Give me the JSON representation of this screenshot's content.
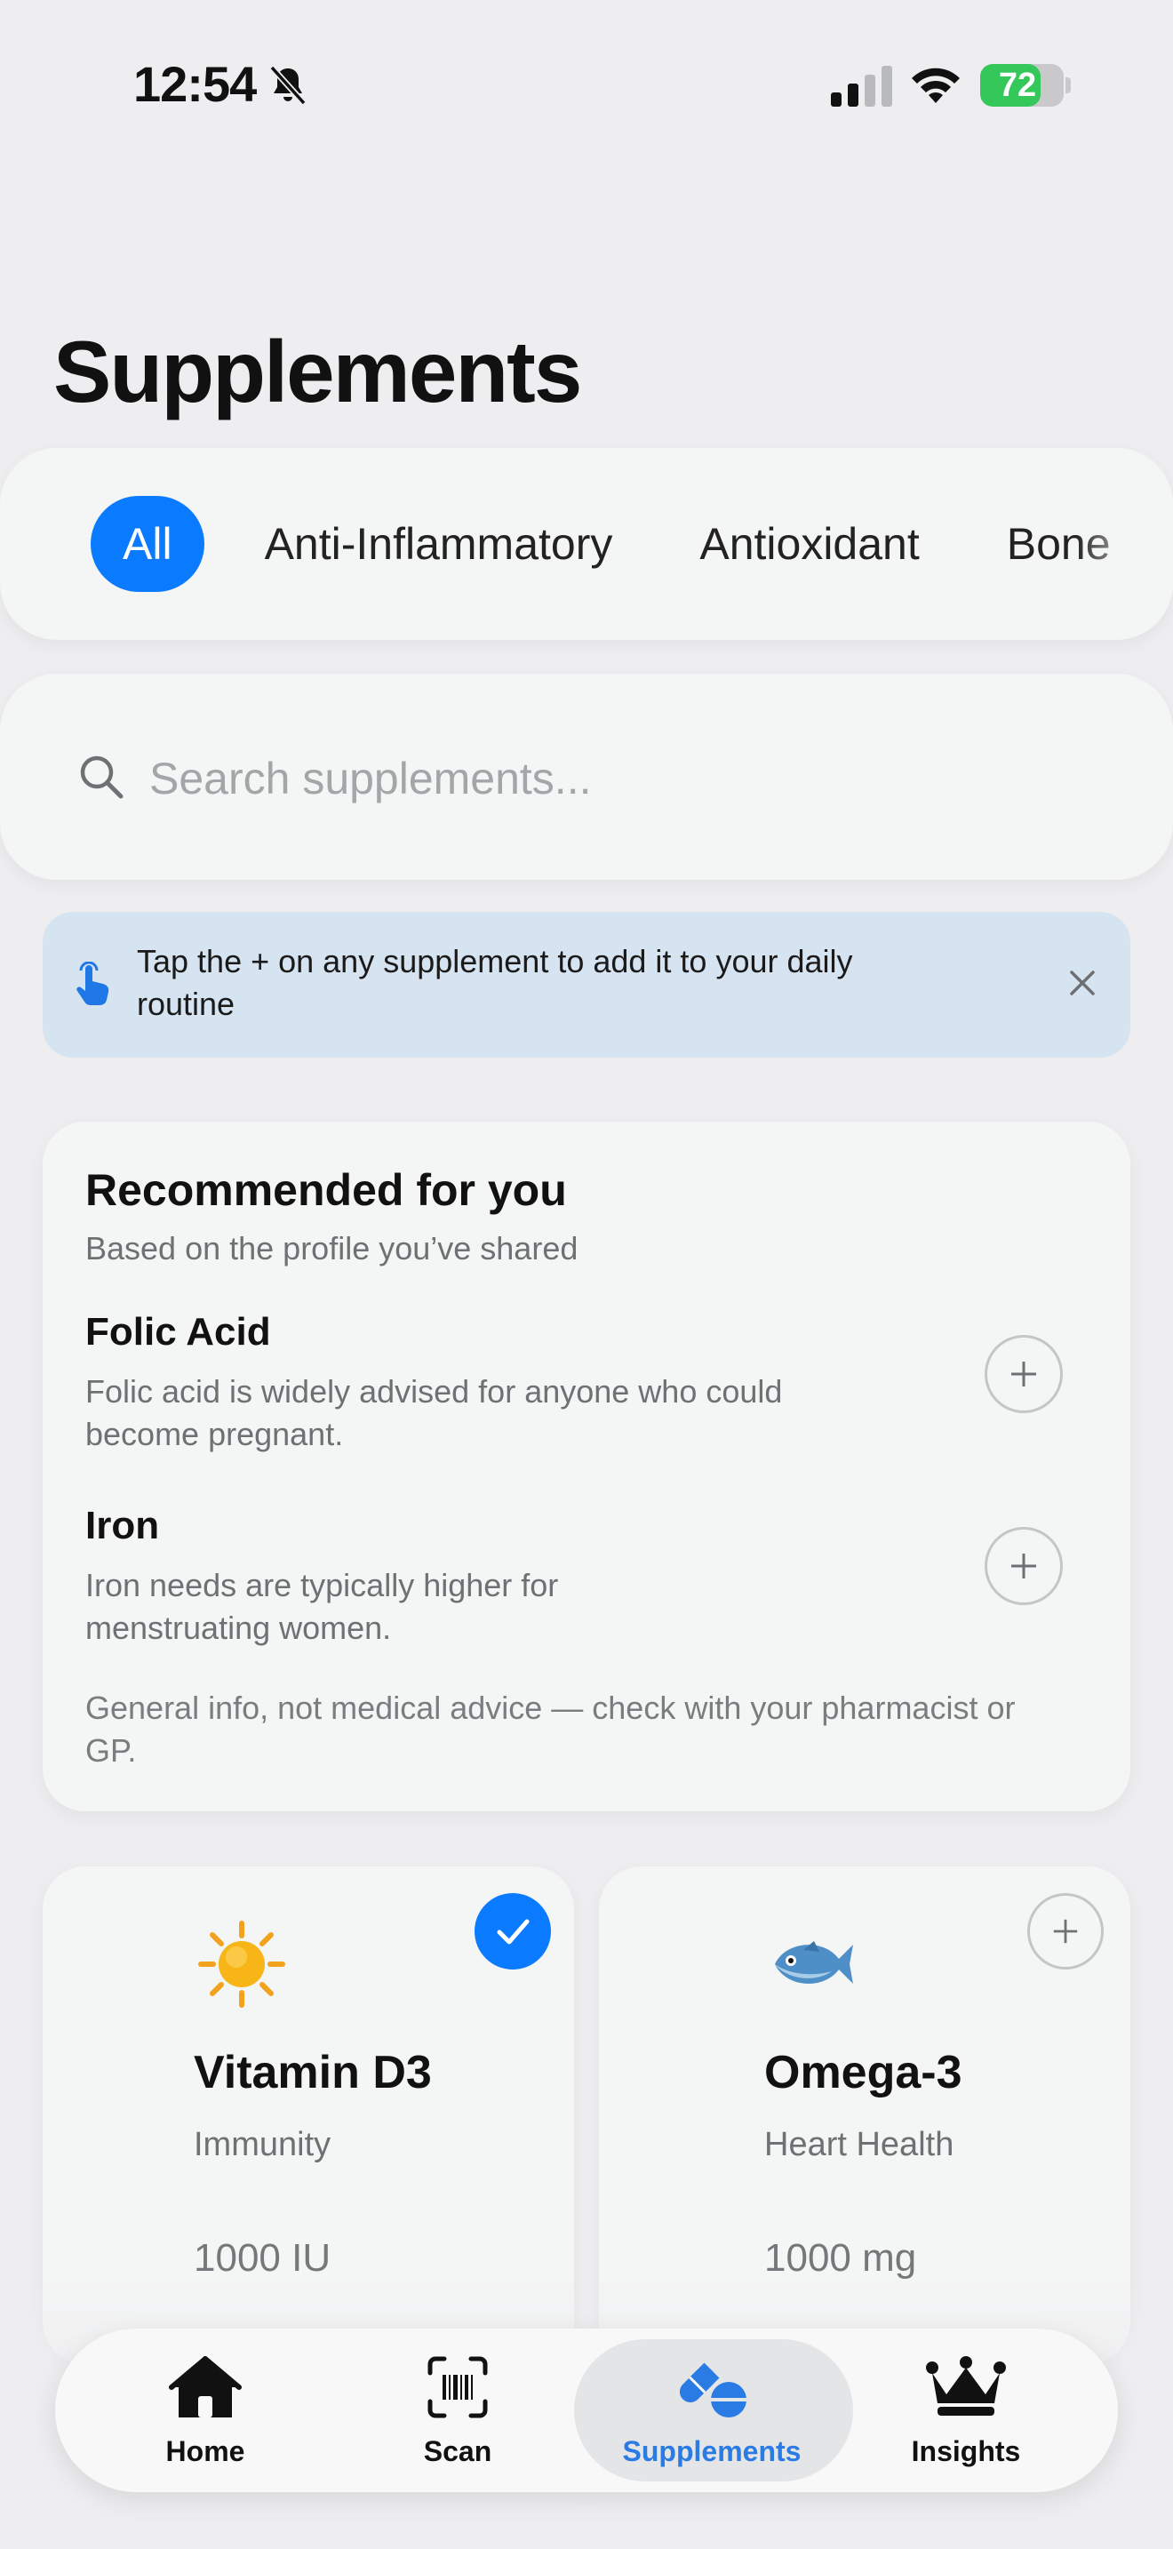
{
  "status_bar": {
    "time": "12:54",
    "battery": "72",
    "battery_level": 0.72
  },
  "page": {
    "title": "Supplements"
  },
  "filters": {
    "chips": [
      "All",
      "Anti-Inflammatory",
      "Antioxidant",
      "Bone"
    ],
    "selected": "All"
  },
  "search": {
    "placeholder": "Search supplements..."
  },
  "tip": {
    "text": "Tap the + on any supplement to add it to your daily routine"
  },
  "recommended": {
    "title": "Recommended for you",
    "subtitle": "Based on the profile you’ve shared",
    "items": [
      {
        "name": "Folic Acid",
        "description": "Folic acid is widely advised for anyone who could become pregnant."
      },
      {
        "name": "Iron",
        "description": "Iron needs are typically higher for menstruating women."
      }
    ],
    "disclaimer": "General info, not medical advice — check with your pharmacist or GP."
  },
  "supplements": [
    {
      "name": "Vitamin D3",
      "category": "Immunity",
      "dose": "1000 IU",
      "emoji": "☀️",
      "added": true
    },
    {
      "name": "Omega-3",
      "category": "Heart Health",
      "dose": "1000 mg",
      "emoji": "🐟",
      "added": false
    }
  ],
  "tabbar": {
    "tabs": [
      {
        "label": "Home",
        "icon": "home-icon"
      },
      {
        "label": "Scan",
        "icon": "barcode-scan-icon"
      },
      {
        "label": "Supplements",
        "icon": "pills-icon"
      },
      {
        "label": "Insights",
        "icon": "crown-icon"
      }
    ],
    "active": "Supplements"
  },
  "colors": {
    "accent": "#0a7aff",
    "tab_active": "#2a7be4",
    "battery": "#34c759",
    "tip_background": "#d6e3f0"
  }
}
